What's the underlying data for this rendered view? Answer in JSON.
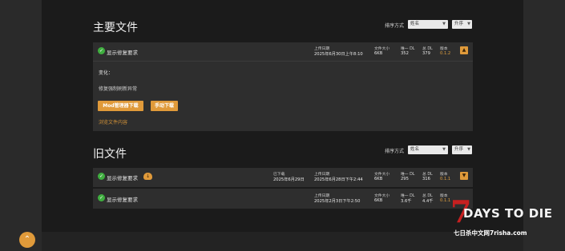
{
  "main_files": {
    "heading": "主要文件",
    "sort_label": "排序方式",
    "sort_value": "姓名",
    "order_value": "升序",
    "file": {
      "title": "显示修复要求",
      "uploaded_label": "上传日期",
      "uploaded_value": "2025年6月30日上午8:10",
      "size_label": "文件大小",
      "size_value": "6KB",
      "unique_dl_label": "唯一 DL",
      "unique_dl_value": "352",
      "total_dl_label": "总 DL",
      "total_dl_value": "379",
      "version_label": "版本",
      "version_value": "0.1.2"
    },
    "details": {
      "changes_label": "变化：",
      "changes_text": "修复强制刷新异常",
      "mod_manager_button": "Mod管理器下载",
      "manual_button": "手动下载",
      "browse_link": "浏览文件内容"
    }
  },
  "old_files": {
    "heading": "旧文件",
    "sort_label": "排序方式",
    "sort_value": "姓名",
    "order_value": "升序",
    "files": [
      {
        "title": "显示修复要求",
        "downloaded_label": "已下载",
        "downloaded_value": "2025年6月29日",
        "uploaded_label": "上传日期",
        "uploaded_value": "2025年6月28日下午2:44",
        "size_label": "文件大小",
        "size_value": "6KB",
        "unique_dl_label": "唯一 DL",
        "unique_dl_value": "295",
        "total_dl_label": "总 DL",
        "total_dl_value": "316",
        "version_label": "版本",
        "version_value": "0.1.1"
      },
      {
        "title": "显示修复要求",
        "uploaded_label": "上传日期",
        "uploaded_value": "2025年2月3日下午2:50",
        "size_label": "文件大小",
        "size_value": "6KB",
        "unique_dl_label": "唯一 DL",
        "unique_dl_value": "3.6千",
        "total_dl_label": "总 DL",
        "total_dl_value": "4.4千",
        "version_label": "版本",
        "version_value": "0.1.1"
      }
    ]
  },
  "watermark": {
    "digit": "7",
    "word": "DAYS TO DIE",
    "subtitle": "七日杀中文网7risha.com"
  },
  "colors": {
    "accent": "#e09a3a",
    "check": "#3fae3f",
    "panel": "#2e2e2e",
    "background": "#1b1b1b"
  },
  "icons": [
    "check-circle-icon",
    "chevron-down-icon",
    "chevron-up-icon",
    "cloud-download-icon"
  ]
}
